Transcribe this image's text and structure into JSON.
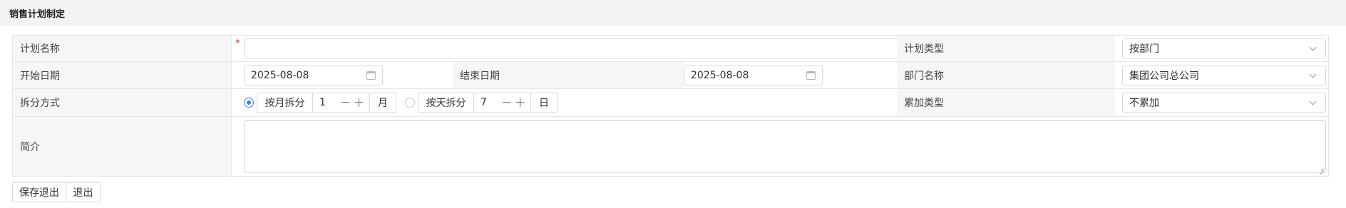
{
  "page": {
    "title": "销售计划制定"
  },
  "form": {
    "plan_name": {
      "label": "计划名称",
      "required_mark": "*",
      "value": ""
    },
    "plan_type": {
      "label": "计划类型",
      "value": "按部门"
    },
    "start_date": {
      "label": "开始日期",
      "value": "2025-08-08"
    },
    "end_date": {
      "label": "结束日期",
      "value": "2025-08-08"
    },
    "department": {
      "label": "部门名称",
      "value": "集团公司总公司"
    },
    "split": {
      "label": "拆分方式",
      "by_month": {
        "label": "按月拆分",
        "value": "1",
        "unit": "月",
        "checked": true
      },
      "by_day": {
        "label": "按天拆分",
        "value": "7",
        "unit": "日",
        "checked": false
      }
    },
    "accumulate_type": {
      "label": "累加类型",
      "value": "不累加"
    },
    "intro": {
      "label": "简介",
      "value": ""
    }
  },
  "actions": {
    "save_exit": "保存退出",
    "exit": "退出"
  },
  "colors": {
    "accent": "#3b82f6",
    "required": "#e4393c",
    "label_bg": "#f5f6f8",
    "header_bg": "#f2f3f5"
  }
}
